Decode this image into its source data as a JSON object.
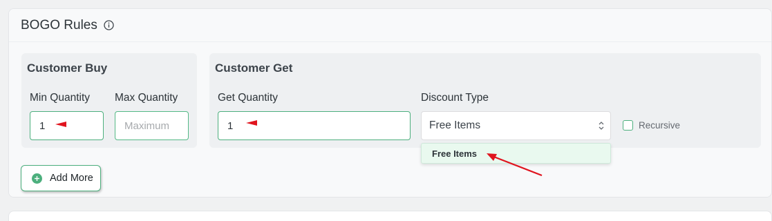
{
  "header": {
    "title": "BOGO Rules",
    "info_icon": "info-circle-icon"
  },
  "customer_buy": {
    "title": "Customer Buy",
    "min_label": "Min Quantity",
    "min_value": "1",
    "max_label": "Max Quantity",
    "max_placeholder": "Maximum"
  },
  "customer_get": {
    "title": "Customer Get",
    "get_label": "Get Quantity",
    "get_value": "1",
    "discount_label": "Discount Type",
    "discount_selected": "Free Items",
    "dropdown_option": "Free Items",
    "recursive_label": "Recursive"
  },
  "actions": {
    "add_more_label": "Add More",
    "add_icon": "plus-circle-icon"
  },
  "colors": {
    "accent": "#4caf7d",
    "annotation": "#e0141e"
  }
}
